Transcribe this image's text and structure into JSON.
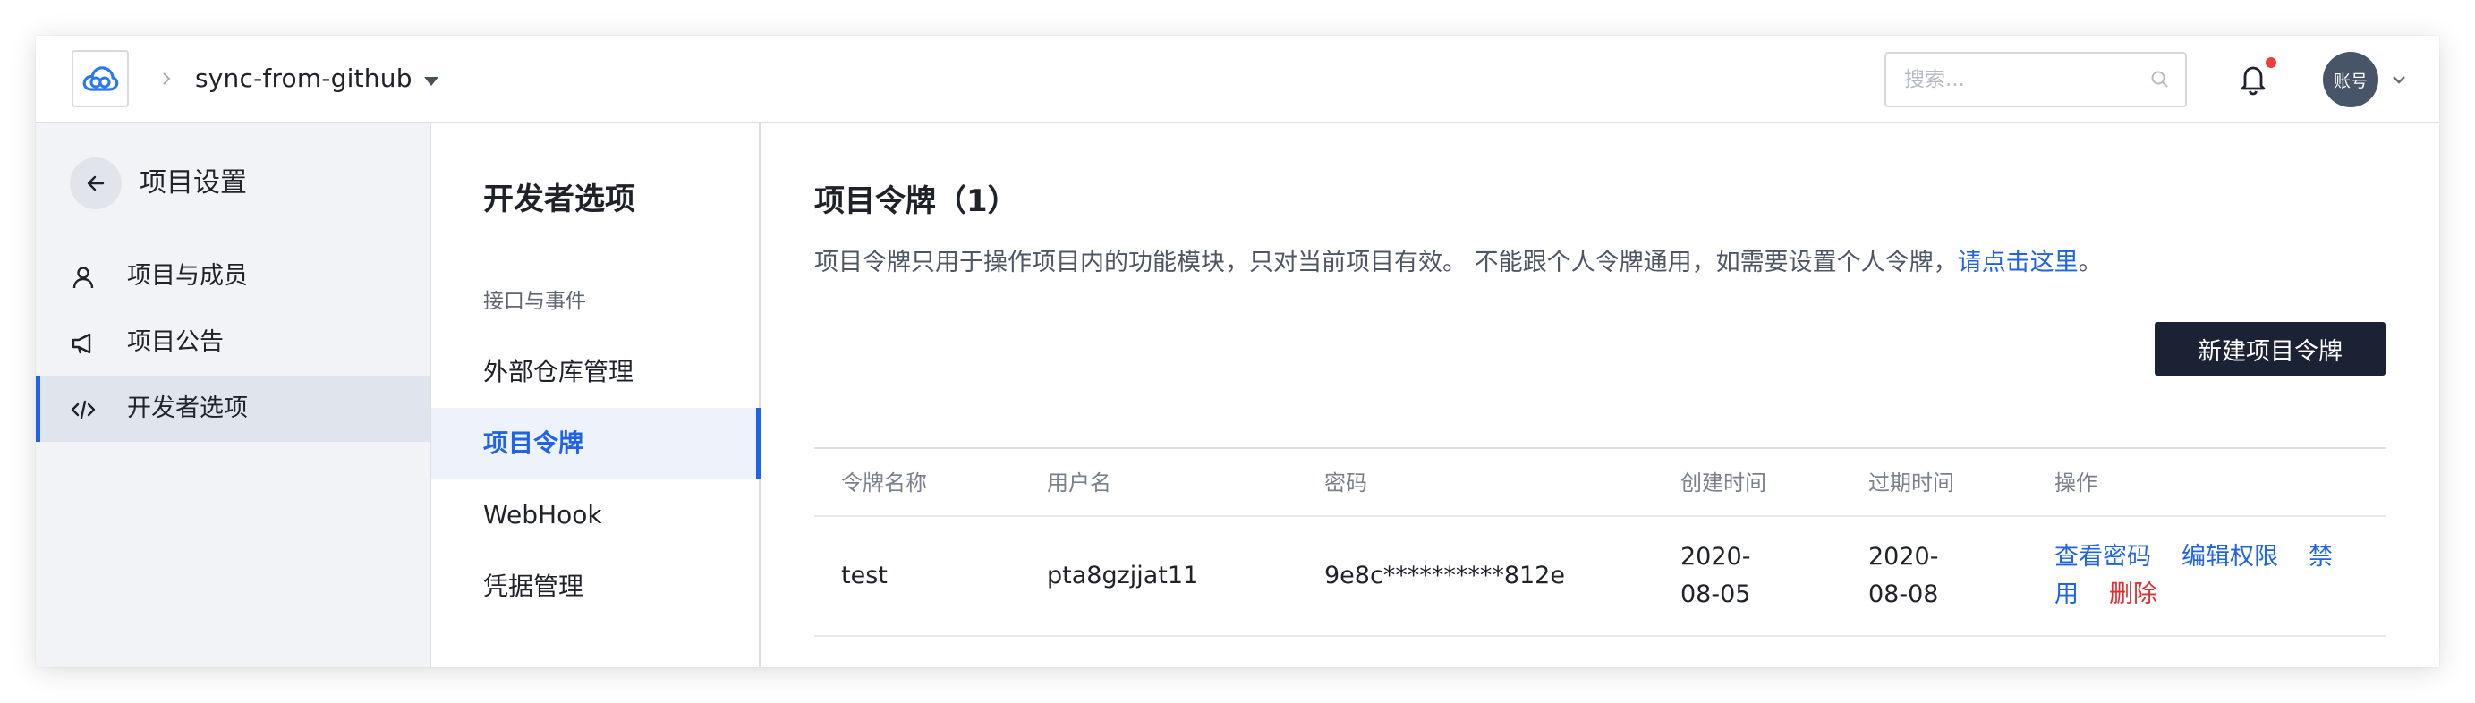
{
  "header": {
    "project_name": "sync-from-github",
    "search_placeholder": "搜索...",
    "avatar_text": "账号"
  },
  "sidebar": {
    "title": "项目设置",
    "items": [
      {
        "label": "项目与成员",
        "icon": "user-icon"
      },
      {
        "label": "项目公告",
        "icon": "megaphone-icon"
      },
      {
        "label": "开发者选项",
        "icon": "code-icon",
        "active": true
      }
    ]
  },
  "submenu": {
    "title": "开发者选项",
    "group_label": "接口与事件",
    "items": [
      {
        "label": "外部仓库管理"
      },
      {
        "label": "项目令牌",
        "active": true
      },
      {
        "label": "WebHook"
      },
      {
        "label": "凭据管理"
      }
    ]
  },
  "main": {
    "title": "项目令牌（1）",
    "description": "项目令牌只用于操作项目内的功能模块，只对当前项目有效。 不能跟个人令牌通用，如需要设置个人令牌，",
    "description_link": "请点击这里",
    "description_end": "。",
    "new_button": "新建项目令牌",
    "table": {
      "columns": [
        "令牌名称",
        "用户名",
        "密码",
        "创建时间",
        "过期时间",
        "操作"
      ],
      "rows": [
        {
          "name": "test",
          "username": "pta8gzjjat11",
          "password": "9e8c**********812e",
          "created": "2020-08-05",
          "expires": "2020-08-08",
          "actions": [
            "查看密码",
            "编辑权限",
            "禁用",
            "删除"
          ]
        }
      ]
    }
  },
  "colors": {
    "accent": "#1f63e8",
    "danger": "#e02f2f",
    "dark_button": "#1a2233",
    "sidebar_bg": "#f1f3f7"
  }
}
